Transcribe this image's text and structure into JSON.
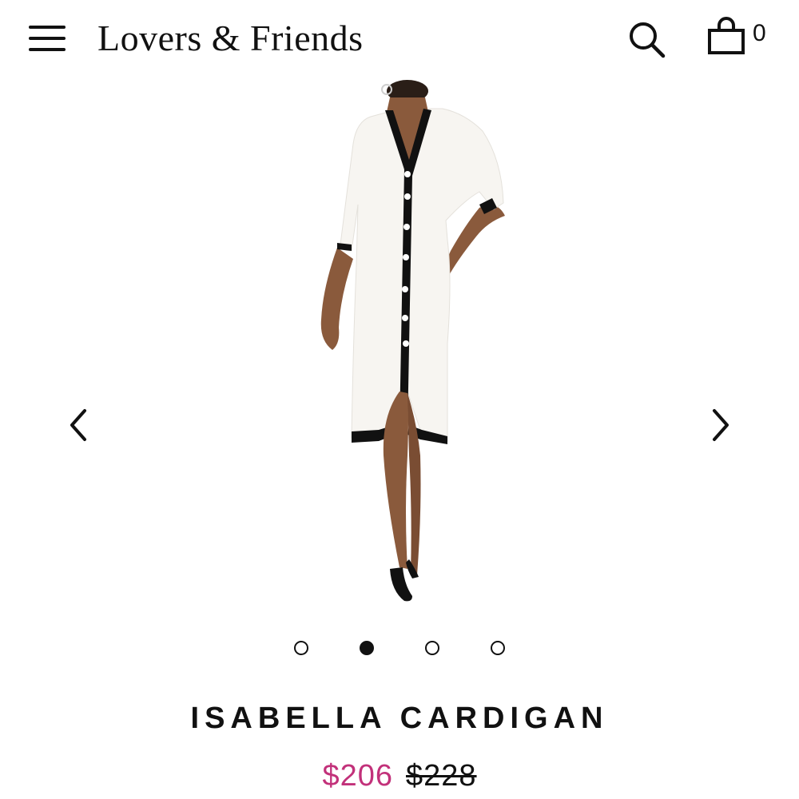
{
  "header": {
    "brand": "Lovers & Friends",
    "cart_count": "0",
    "icons": {
      "menu": "hamburger-menu-icon",
      "search": "search-icon",
      "cart": "shopping-bag-icon"
    }
  },
  "carousel": {
    "image_alt": "model wearing white cardigan dress with black trim",
    "total_slides": 4,
    "active_slide": 2,
    "icons": {
      "prev": "chevron-left-icon",
      "next": "chevron-right-icon"
    }
  },
  "product": {
    "title": "ISABELLA CARDIGAN",
    "sale_price": "$206",
    "original_price": "$228"
  },
  "colors": {
    "sale_price": "#c2317a",
    "text": "#111111",
    "background": "#ffffff",
    "garment_trim": "#111111",
    "garment": "#f7f5f1"
  }
}
